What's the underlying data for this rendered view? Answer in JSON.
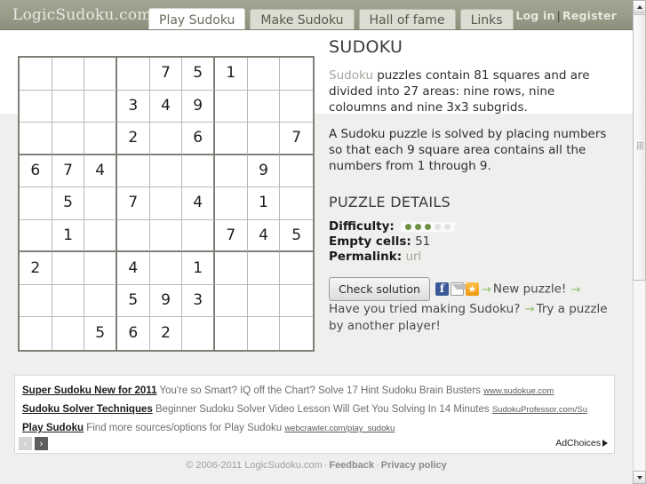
{
  "header": {
    "logo": "LogicSudoku.com",
    "tabs": [
      {
        "label": "Play Sudoku",
        "active": true
      },
      {
        "label": "Make Sudoku",
        "active": false
      },
      {
        "label": "Hall of fame",
        "active": false
      },
      {
        "label": "Links",
        "active": false
      }
    ],
    "login_label": "Log in",
    "divider": "|",
    "register_label": "Register"
  },
  "sudoku": {
    "grid": [
      [
        "",
        "",
        "",
        "",
        "7",
        "5",
        "1",
        "",
        ""
      ],
      [
        "",
        "",
        "",
        "3",
        "4",
        "9",
        "",
        "",
        ""
      ],
      [
        "",
        "",
        "",
        "2",
        "",
        "6",
        "",
        "",
        "7"
      ],
      [
        "6",
        "7",
        "4",
        "",
        "",
        "",
        "",
        "9",
        ""
      ],
      [
        "",
        "5",
        "",
        "7",
        "",
        "4",
        "",
        "1",
        ""
      ],
      [
        "",
        "1",
        "",
        "",
        "",
        "",
        "7",
        "4",
        "5"
      ],
      [
        "2",
        "",
        "",
        "4",
        "",
        "1",
        "",
        "",
        ""
      ],
      [
        "",
        "",
        "",
        "5",
        "9",
        "3",
        "",
        "",
        ""
      ],
      [
        "",
        "",
        "5",
        "6",
        "2",
        "",
        "",
        "",
        ""
      ]
    ]
  },
  "panel": {
    "heading": "SUDOKU",
    "intro_link": "Sudoku",
    "intro_rest": " puzzles contain 81 squares and are divided into 27 areas: nine rows, nine coloumns and nine 3x3 subgrids.",
    "paragraph2": "A Sudoku puzzle is solved by placing numbers so that each 9 square area contains all the numbers from 1 through 9.",
    "details_heading": "PUZZLE DETAILS",
    "difficulty_label": "Difficulty:",
    "difficulty_filled": 3,
    "difficulty_total": 5,
    "difficulty_on_color": "#6f9142",
    "difficulty_off_color": "#e2e2e2",
    "empty_cells_label": "Empty cells:",
    "empty_cells_value": "51",
    "permalink_label": "Permalink:",
    "permalink_value": "url",
    "check_solution_label": "Check solution",
    "share": {
      "facebook": "f",
      "email": "",
      "favorite": "★"
    },
    "link_new_puzzle": "New puzzle!",
    "link_make_sudoku": "Have you tried making Sudoku?",
    "link_another_player": "Try a puzzle by another player!"
  },
  "ads": [
    {
      "title": "Super Sudoku New for 2011",
      "text": "You're so Smart? IQ off the Chart? Solve 17 Hint Sudoku Brain Busters",
      "url": "www.sudokue.com"
    },
    {
      "title": "Sudoku Solver Techniques",
      "text": "Beginner Sudoku Solver Video Lesson Will Get You Solving In 14 Minutes",
      "url": "SudokuProfessor.com/Su"
    },
    {
      "title": "Play Sudoku",
      "text": "Find more sources/options for Play Sudoku",
      "url": "webcrawler.com/play_sudoku"
    }
  ],
  "adnav": {
    "prev": "‹",
    "next": "›",
    "adchoices": "AdChoices"
  },
  "footer": {
    "copyright": "© 2006-2011 LogicSudoku.com",
    "sep1": "·",
    "feedback": "Feedback",
    "sep2": "·",
    "privacy": "Privacy policy"
  }
}
